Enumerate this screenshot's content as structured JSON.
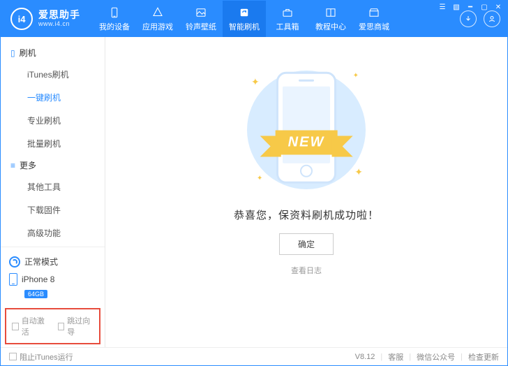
{
  "brand": {
    "logo_text": "i4",
    "title": "爱思助手",
    "subtitle": "www.i4.cn"
  },
  "nav": {
    "items": [
      {
        "label": "我的设备"
      },
      {
        "label": "应用游戏"
      },
      {
        "label": "铃声壁纸"
      },
      {
        "label": "智能刷机"
      },
      {
        "label": "工具箱"
      },
      {
        "label": "教程中心"
      },
      {
        "label": "爱思商城"
      }
    ]
  },
  "sidebar": {
    "group1": {
      "title": "刷机"
    },
    "items1": [
      {
        "label": "iTunes刷机"
      },
      {
        "label": "一键刷机"
      },
      {
        "label": "专业刷机"
      },
      {
        "label": "批量刷机"
      }
    ],
    "group2": {
      "title": "更多"
    },
    "items2": [
      {
        "label": "其他工具"
      },
      {
        "label": "下载固件"
      },
      {
        "label": "高级功能"
      }
    ],
    "mode": "正常模式",
    "device": "iPhone 8",
    "storage": "64GB",
    "opt_auto_activate": "自动激活",
    "opt_skip_guide": "跳过向导"
  },
  "main": {
    "ribbon": "NEW",
    "message": "恭喜您，保资料刷机成功啦！",
    "confirm": "确定",
    "view_log": "查看日志"
  },
  "footer": {
    "block_itunes": "阻止iTunes运行",
    "version": "V8.12",
    "support": "客服",
    "wechat": "微信公众号",
    "check_update": "检查更新"
  }
}
